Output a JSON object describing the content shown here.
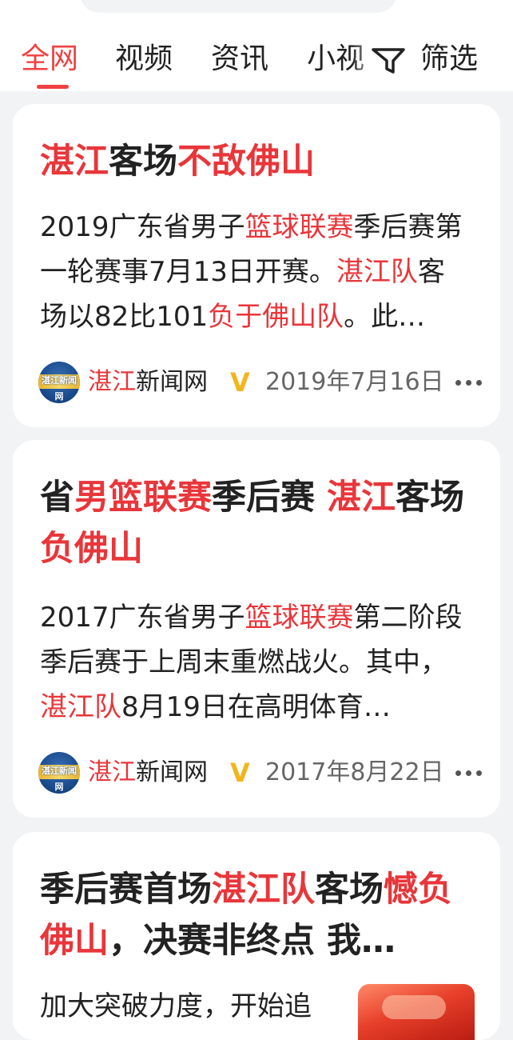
{
  "tabs": [
    {
      "label": "全网",
      "active": true
    },
    {
      "label": "视频",
      "active": false
    },
    {
      "label": "资讯",
      "active": false
    },
    {
      "label": "小视",
      "active": false
    }
  ],
  "filter": {
    "label": "筛选",
    "icon": "filter-funnel-icon"
  },
  "accent_color": "#f04142",
  "highlight_color": "#e8363a",
  "cards": [
    {
      "title": [
        "湛江",
        "客场",
        "不敌佛山"
      ],
      "body": [
        "2019广东省男子",
        "篮球联赛",
        "季后赛第一轮赛事7月13日开赛。",
        "湛江队",
        "客场以82比101",
        "负于佛山队",
        "。此…"
      ],
      "source": "湛江新闻网",
      "source_hl": "湛江",
      "source_rest": "新闻网",
      "verified": "V",
      "date": "2019年7月16日",
      "avatar_text": "湛江新闻网"
    },
    {
      "title": [
        "省",
        "男篮联赛",
        "季后赛 ",
        "湛江",
        "客场",
        "负佛山"
      ],
      "body": [
        "2017广东省男子",
        "篮球联赛",
        "第二阶段季后赛于上周末重燃战火。其中，",
        "湛江队",
        "8月19日在高明体育…"
      ],
      "source": "湛江新闻网",
      "source_hl": "湛江",
      "source_rest": "新闻网",
      "verified": "V",
      "date": "2017年8月22日",
      "avatar_text": "湛江新闻网"
    },
    {
      "title": [
        "季后赛首场",
        "湛江队",
        "客场",
        "憾负佛山",
        "，决赛非终点 我…"
      ],
      "body": [
        "加大突破力度，开始追"
      ]
    }
  ]
}
